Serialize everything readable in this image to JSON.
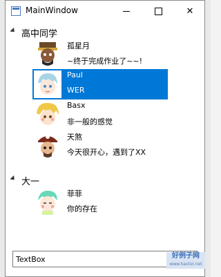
{
  "window": {
    "title": "MainWindow"
  },
  "groups": [
    {
      "name": "高中同学",
      "friends": [
        {
          "name": "孤星月",
          "message": "~终于完成作业了~~!",
          "selected": false
        },
        {
          "name": "Paul",
          "message": "WER",
          "selected": true
        },
        {
          "name": "Basx",
          "message": "非一般的感觉",
          "selected": false
        },
        {
          "name": "天煞",
          "message": "今天很开心，遇到了XX",
          "selected": false
        }
      ]
    },
    {
      "name": "大一",
      "friends": [
        {
          "name": "菲菲",
          "message": "你的存在",
          "selected": false
        }
      ]
    }
  ],
  "textbox": {
    "value": "TextBox"
  },
  "watermark": {
    "line1": "好例子网",
    "line2": "www.haolizi.net"
  },
  "colors": {
    "selection": "#0078d7"
  }
}
